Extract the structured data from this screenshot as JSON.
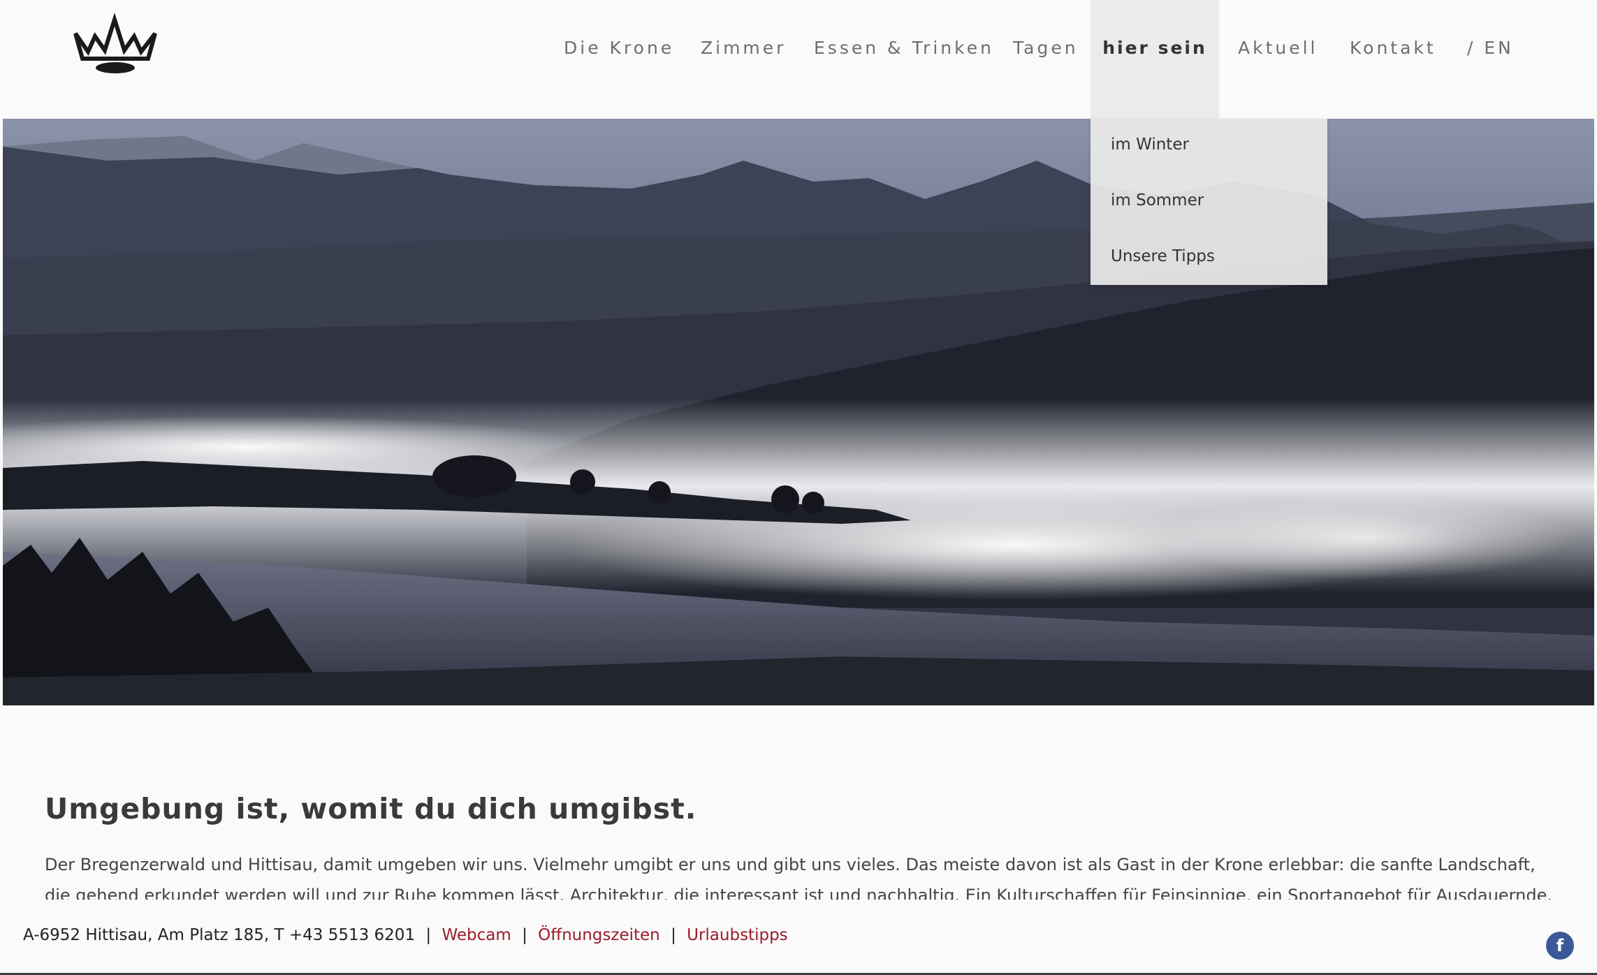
{
  "header": {
    "logo": "crown-logo",
    "nav": [
      {
        "label": "Die Krone"
      },
      {
        "label": "Zimmer"
      },
      {
        "label": "Essen & Trinken"
      },
      {
        "label": "Tagen"
      },
      {
        "label": "hier sein",
        "active": true
      },
      {
        "label": "Aktuell"
      },
      {
        "label": "Kontakt"
      },
      {
        "label": "/ EN"
      }
    ]
  },
  "dropdown": {
    "items": [
      {
        "label": "im Winter"
      },
      {
        "label": "im Sommer"
      },
      {
        "label": "Unsere Tipps"
      }
    ]
  },
  "hero": {
    "image": "foggy-mountain-landscape"
  },
  "content": {
    "heading": "Umgebung ist, womit du dich umgibst.",
    "paragraph": "Der Bregenzerwald und Hittisau, damit umgeben wir uns. Vielmehr umgibt er uns und gibt uns vieles. Das meiste davon ist als Gast in der Krone erlebbar: die sanfte Landschaft, die gehend erkundet werden will und zur Ruhe kommen lässt. Architektur, die interessant ist und nachhaltig. Ein Kulturschaffen für Feinsinnige, ein Sportangebot für Ausdauernde."
  },
  "footer": {
    "address": "A-6952 Hittisau, Am Platz 185, T +43 5513 6201",
    "separator": "|",
    "links": [
      {
        "label": "Webcam"
      },
      {
        "label": "Öffnungszeiten"
      },
      {
        "label": "Urlaubstipps"
      }
    ],
    "facebook_glyph": "f",
    "link_color": "#9b1b2a"
  }
}
